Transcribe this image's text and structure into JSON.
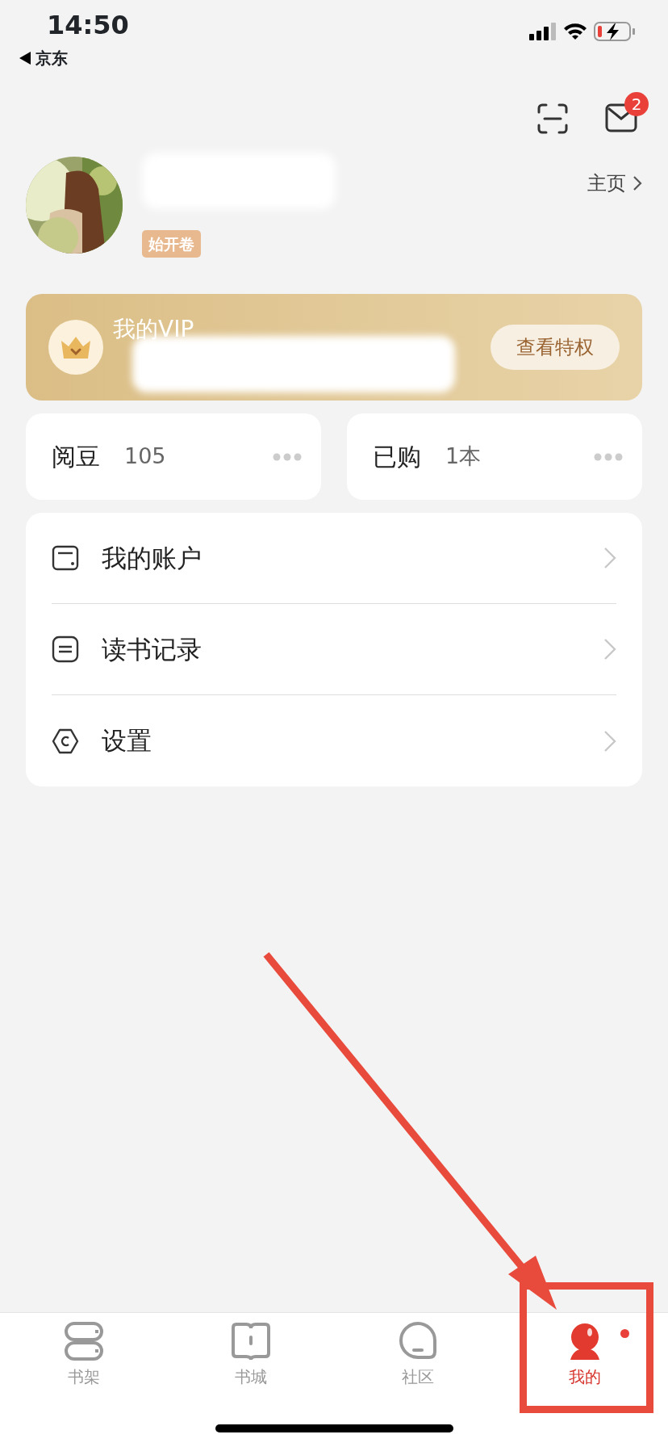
{
  "status_bar": {
    "time": "14:50",
    "back_app": "京东"
  },
  "header": {
    "message_badge": "2"
  },
  "profile": {
    "badge": "始开卷",
    "home_link": "主页"
  },
  "vip_card": {
    "title": "我的VIP",
    "button": "查看特权"
  },
  "stats": [
    {
      "label": "阅豆",
      "value": "105"
    },
    {
      "label": "已购",
      "value": "1本"
    }
  ],
  "menu": [
    {
      "kind": "account",
      "label": "我的账户"
    },
    {
      "kind": "history",
      "label": "读书记录"
    },
    {
      "kind": "settings",
      "label": "设置"
    }
  ],
  "tabs": [
    {
      "kind": "shelf",
      "label": "书架",
      "selected": false,
      "dot": false
    },
    {
      "kind": "store",
      "label": "书城",
      "selected": false,
      "dot": false
    },
    {
      "kind": "community",
      "label": "社区",
      "selected": false,
      "dot": false
    },
    {
      "kind": "me",
      "label": "我的",
      "selected": true,
      "dot": true
    }
  ]
}
